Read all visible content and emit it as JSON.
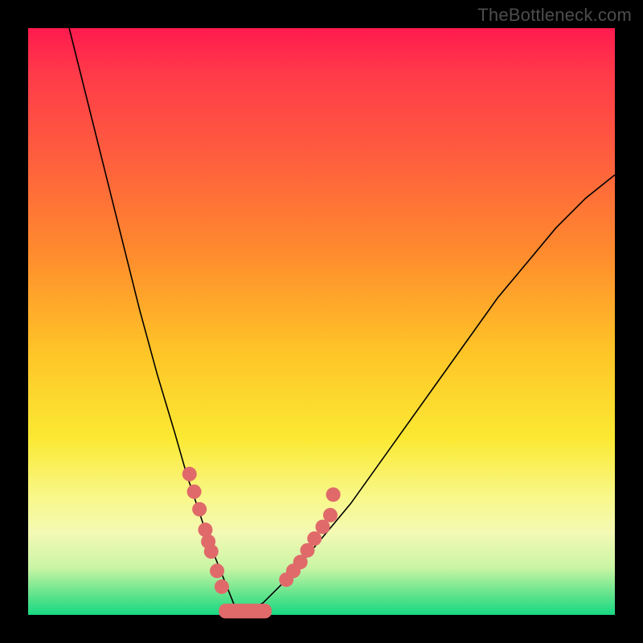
{
  "attribution": "TheBottleneck.com",
  "colors": {
    "marker": "#e06a6a",
    "curve": "#000000",
    "frame": "#000000",
    "gradient_top": "#ff1a4e",
    "gradient_bottom": "#18d884"
  },
  "chart_data": {
    "type": "line",
    "title": "",
    "xlabel": "",
    "ylabel": "",
    "xlim": [
      0,
      100
    ],
    "ylim": [
      0,
      100
    ],
    "x_vertex": 36,
    "curve_left": {
      "description": "steep descending branch from top-left to vertex",
      "x": [
        7,
        10,
        13,
        16,
        19,
        22,
        25,
        27,
        29,
        31,
        33,
        35,
        36
      ],
      "y": [
        100,
        88,
        76,
        64,
        52,
        41,
        31,
        24,
        18,
        12,
        7,
        2,
        0
      ]
    },
    "curve_right": {
      "description": "gently rising branch from vertex toward upper-right",
      "x": [
        36,
        40,
        45,
        50,
        55,
        60,
        65,
        70,
        75,
        80,
        85,
        90,
        95,
        100
      ],
      "y": [
        0,
        2,
        7,
        13,
        19,
        26,
        33,
        40,
        47,
        54,
        60,
        66,
        71,
        75
      ]
    },
    "flat_band": {
      "x_start": 32.5,
      "x_end": 41.5,
      "y": 0.5
    },
    "markers_left_cluster": [
      {
        "x": 27.5,
        "y": 24
      },
      {
        "x": 28.3,
        "y": 21
      },
      {
        "x": 29.2,
        "y": 18
      },
      {
        "x": 30.2,
        "y": 14.5
      },
      {
        "x": 30.7,
        "y": 12.5
      },
      {
        "x": 31.2,
        "y": 10.8
      },
      {
        "x": 32.2,
        "y": 7.5
      },
      {
        "x": 33.0,
        "y": 4.8
      }
    ],
    "markers_right_cluster": [
      {
        "x": 44.0,
        "y": 6.0
      },
      {
        "x": 45.2,
        "y": 7.5
      },
      {
        "x": 46.4,
        "y": 9.0
      },
      {
        "x": 47.6,
        "y": 11.0
      },
      {
        "x": 48.8,
        "y": 13.0
      },
      {
        "x": 50.2,
        "y": 15.0
      },
      {
        "x": 51.5,
        "y": 17.0
      },
      {
        "x": 52.0,
        "y": 20.5
      }
    ]
  }
}
